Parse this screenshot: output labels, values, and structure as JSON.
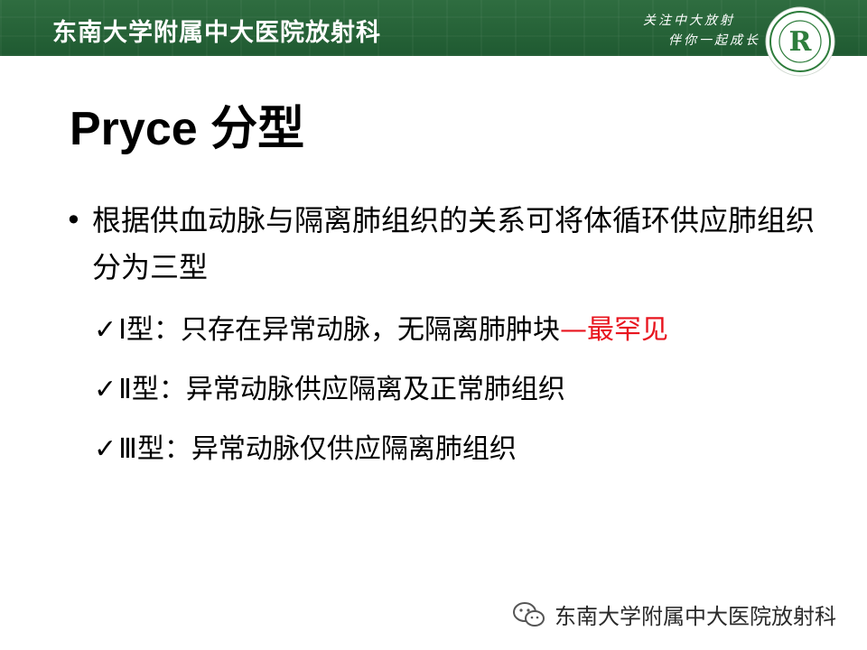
{
  "header": {
    "org_name": "东南大学附属中大医院放射科",
    "slogan_line1": "关注中大放射",
    "slogan_line2": "伴你一起成长",
    "logo_letter": "R",
    "logo_color": "#2e7d3c"
  },
  "slide": {
    "title": "Pryce 分型",
    "bullet": {
      "marker": "•",
      "text": "根据供血动脉与隔离肺组织的关系可将体循环供应肺组织分为三型"
    },
    "subitems": [
      {
        "check": "✓",
        "prefix": "Ⅰ型：只存在异常动脉，无隔离肺肿块",
        "highlight": "—最罕见"
      },
      {
        "check": "✓",
        "prefix": "Ⅱ型：异常动脉供应隔离及正常肺组织",
        "highlight": ""
      },
      {
        "check": "✓",
        "prefix": "Ⅲ型：异常动脉仅供应隔离肺组织",
        "highlight": ""
      }
    ],
    "highlight_color": "#e8141e"
  },
  "footer": {
    "icon": "wechat-icon",
    "text": "东南大学附属中大医院放射科"
  }
}
